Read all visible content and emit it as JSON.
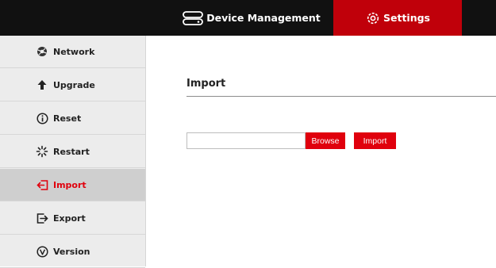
{
  "topnav": {
    "device_management_label": "Device Management",
    "settings_label": "Settings",
    "accent_color": "#c0000a"
  },
  "sidebar": {
    "items": [
      {
        "label": "Network",
        "icon": "network-icon"
      },
      {
        "label": "Upgrade",
        "icon": "arrow-up-icon"
      },
      {
        "label": "Reset",
        "icon": "info-icon"
      },
      {
        "label": "Restart",
        "icon": "spinner-icon"
      },
      {
        "label": "Import",
        "icon": "import-icon",
        "active": true
      },
      {
        "label": "Export",
        "icon": "export-icon"
      },
      {
        "label": "Version",
        "icon": "version-icon"
      }
    ],
    "active_color": "#e0000d"
  },
  "main": {
    "title": "Import",
    "file_input_value": "",
    "browse_label": "Browse",
    "import_label": "Import"
  }
}
